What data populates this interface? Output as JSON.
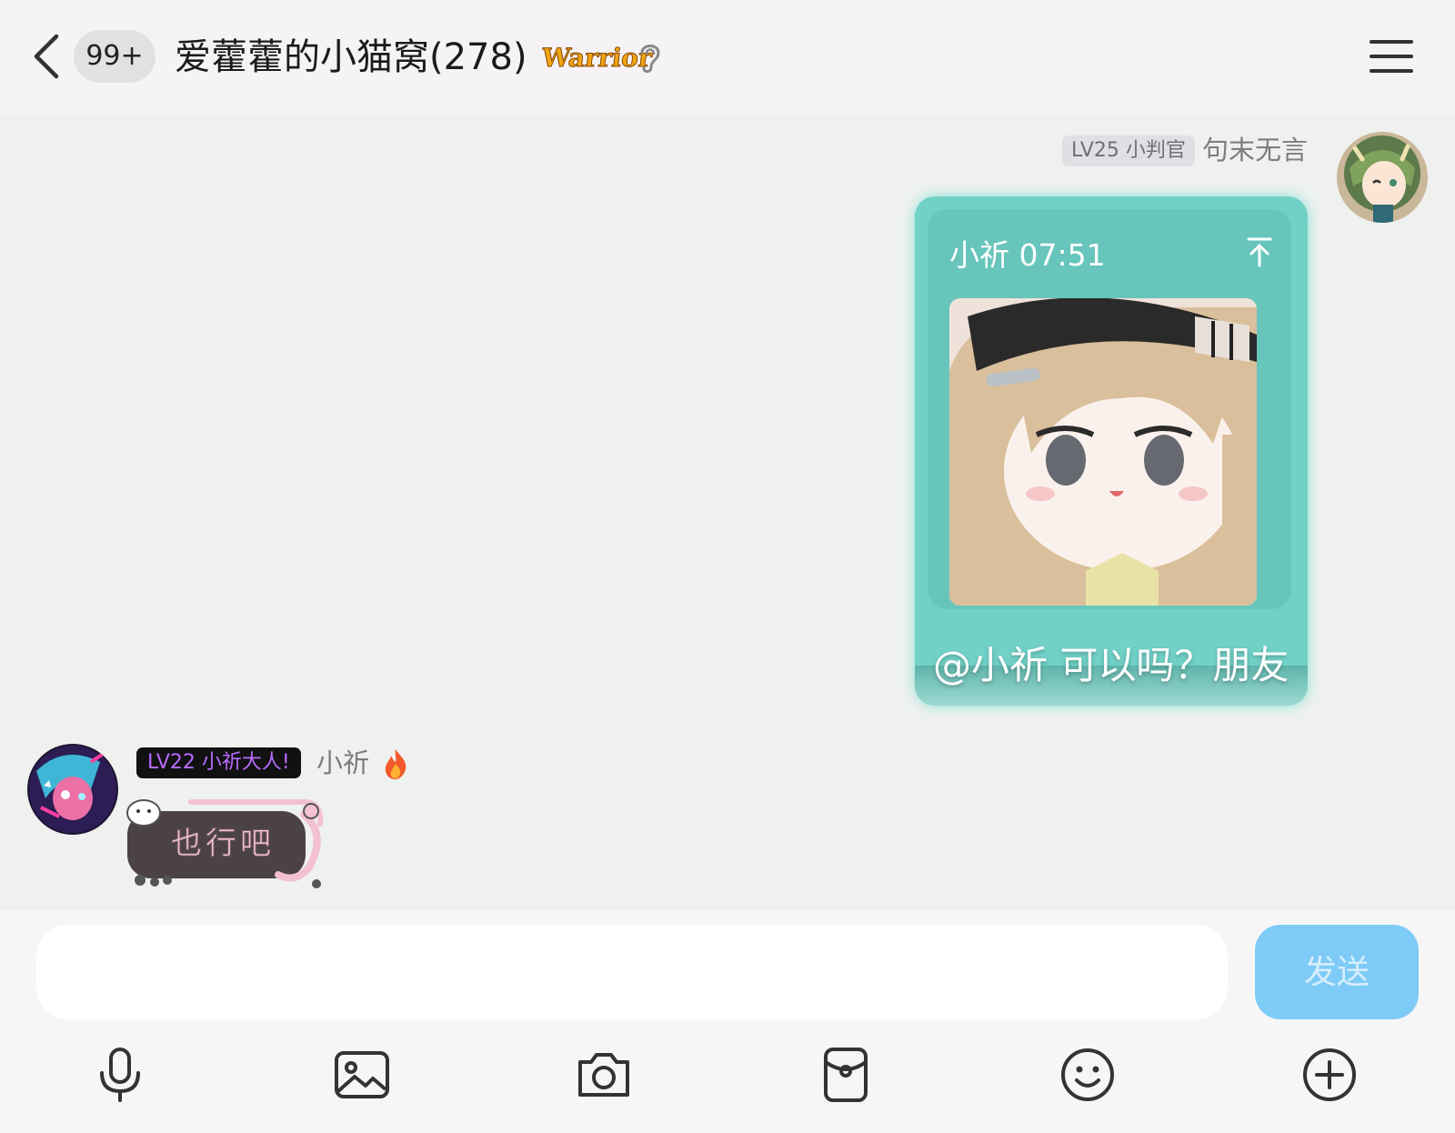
{
  "header": {
    "unread_count": "99+",
    "group_title": "爱藿藿的小猫窝(278)",
    "badge_text": "Warrior"
  },
  "messages": [
    {
      "side": "right",
      "level_badge": "LV25 小判官",
      "sender": "句末无言",
      "quote": {
        "author_time": "小祈 07:51"
      },
      "text": "@小祈 可以吗？朋友"
    },
    {
      "side": "left",
      "level_badge": "LV22 小祈大人!",
      "sender": "小祈",
      "sticker_text": "也行吧"
    }
  ],
  "composer": {
    "input_value": "",
    "send_label": "发送"
  },
  "toolbar": [
    "microphone-icon",
    "image-icon",
    "camera-icon",
    "red-packet-icon",
    "emoji-icon",
    "add-icon"
  ],
  "colors": {
    "bubble": "#71d1c7",
    "send_button": "#7ecbf7",
    "left_level_text": "#b86bff"
  }
}
